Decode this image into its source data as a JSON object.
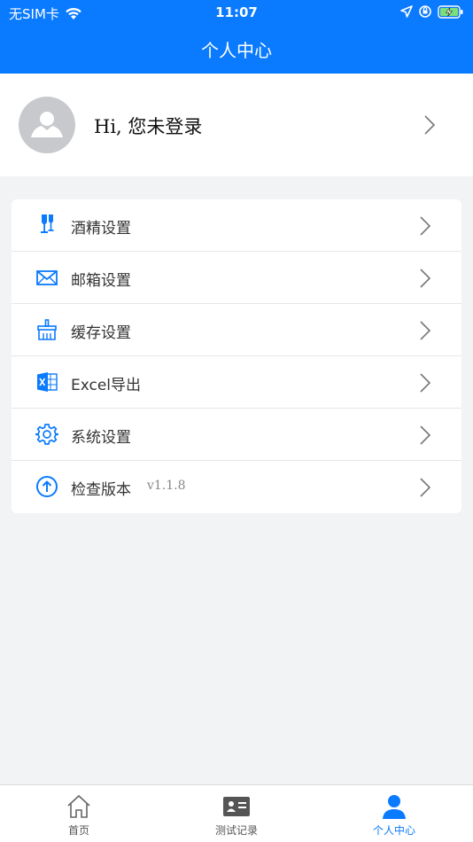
{
  "status_bar": {
    "carrier": "无SIM卡",
    "time": "11:07"
  },
  "nav": {
    "title": "个人中心"
  },
  "profile": {
    "greeting": "Hi, 您未登录"
  },
  "menu": {
    "items": [
      {
        "label": "酒精设置",
        "icon": "wine-glass-icon"
      },
      {
        "label": "邮箱设置",
        "icon": "mail-icon"
      },
      {
        "label": "缓存设置",
        "icon": "broom-icon"
      },
      {
        "label": "Excel导出",
        "icon": "excel-icon"
      },
      {
        "label": "系统设置",
        "icon": "gear-icon"
      },
      {
        "label": "检查版本",
        "icon": "upload-circle-icon",
        "version": "v1.1.8"
      }
    ]
  },
  "tabbar": {
    "tabs": [
      {
        "label": "首页",
        "icon": "home-icon",
        "active": false
      },
      {
        "label": "测试记录",
        "icon": "id-card-icon",
        "active": false
      },
      {
        "label": "个人中心",
        "icon": "person-icon",
        "active": true
      }
    ]
  },
  "colors": {
    "accent": "#0a7aff",
    "background": "#f2f3f5",
    "avatar": "#c7c9cd"
  }
}
